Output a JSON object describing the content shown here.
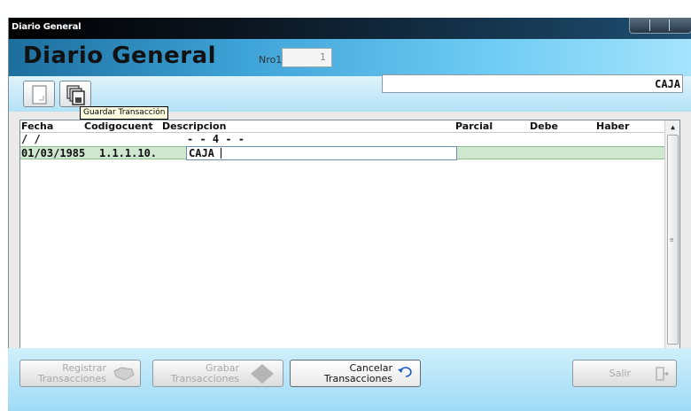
{
  "window": {
    "title": "Diario General"
  },
  "header": {
    "title": "Diario General",
    "nro_label": "Nro1",
    "nro_value": "1"
  },
  "toolbar": {
    "tooltip": "Guardar Transacción",
    "account_display": "CAJA",
    "icons": [
      "new-document-icon",
      "save-transaction-icon"
    ]
  },
  "grid": {
    "columns": [
      "Fecha",
      "Codigocuent",
      "Descripcion",
      "Parcial",
      "Debe",
      "Haber"
    ],
    "rows": [
      {
        "fecha": "/ /",
        "codigo": "",
        "descripcion": "- - 4 - -",
        "parcial": "",
        "debe": "",
        "haber": ""
      },
      {
        "fecha": "01/03/1985",
        "codigo": "1.1.1.10.",
        "descripcion": "CAJA",
        "parcial": "",
        "debe": "",
        "haber": ""
      }
    ]
  },
  "buttons": {
    "registrar": {
      "line1": "Registrar",
      "line2": "Transacciones"
    },
    "grabar": {
      "line1": "Grabar",
      "line2": "Transacciones"
    },
    "cancelar": {
      "line1": "Cancelar",
      "line2": "Transacciones"
    },
    "salir": {
      "label": "Salir"
    }
  },
  "colors": {
    "selected_row": "#cfe6cf",
    "header_gradient_end": "#a6e4fb"
  }
}
